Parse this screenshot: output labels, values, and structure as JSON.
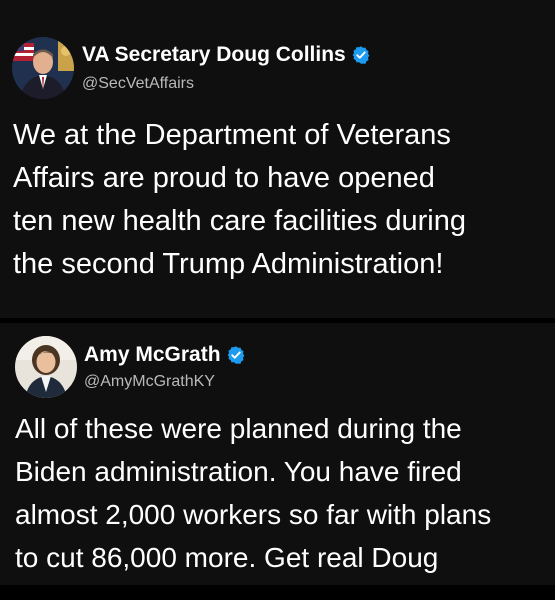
{
  "posts": [
    {
      "display_name": "VA Secretary Doug Collins",
      "handle": "@SecVetAffairs",
      "verified": true,
      "avatar_icon": "profile-photo-man-suit-flag",
      "text_lines": [
        "We at the Department of Veterans",
        "Affairs are proud to have opened",
        "ten new health care facilities during",
        "the second Trump Administration!"
      ]
    },
    {
      "display_name": "Amy McGrath",
      "handle": "@AmyMcGrathKY",
      "verified": true,
      "avatar_icon": "profile-photo-woman-outdoors",
      "text_lines": [
        "All of these were planned during the",
        "Biden administration. You have fired",
        "almost 2,000 workers so far with plans",
        "to cut 86,000 more. Get real Doug"
      ]
    }
  ],
  "colors": {
    "background": "#000000",
    "card": "#0f0f0f",
    "text": "#ffffff",
    "handle": "#b9b9b9",
    "verified_badge": "#1d9bf0"
  }
}
